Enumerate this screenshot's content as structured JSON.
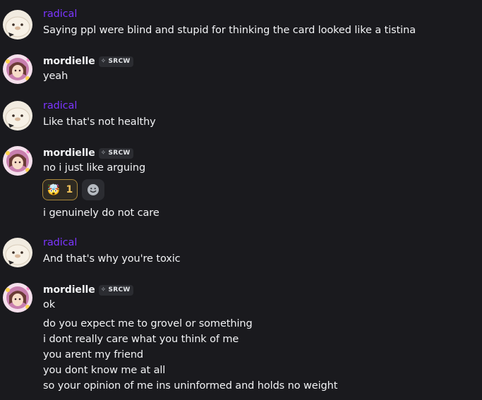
{
  "users": {
    "radical": {
      "name": "radical",
      "color": "#7c35ff",
      "avatar_icon": "seal-plush-avatar"
    },
    "mordielle": {
      "name": "mordielle",
      "tag": "SRCW",
      "tag_icon": "sparkle-diamond-icon",
      "avatar_icon": "anime-girl-sparkle-avatar"
    }
  },
  "messages": [
    {
      "author": "radical",
      "lines": [
        "Saying ppl were blind and stupid for thinking the card looked like a tistina"
      ]
    },
    {
      "author": "mordielle",
      "lines": [
        "yeah"
      ]
    },
    {
      "author": "radical",
      "lines": [
        "Like that's not healthy"
      ]
    },
    {
      "author": "mordielle",
      "lines": [
        "no i just like arguing"
      ],
      "reactions": [
        {
          "emoji": "🤯",
          "count": "1"
        }
      ],
      "followups": [
        "i genuinely do not care"
      ]
    },
    {
      "author": "radical",
      "lines": [
        "And that's why you're toxic"
      ]
    },
    {
      "author": "mordielle",
      "lines": [
        "ok"
      ],
      "followups": [
        "do you expect me to grovel or something",
        "i dont really care what you think of me",
        "you arent my friend",
        "you dont know me at all",
        "so your opinion of me ins uninformed and holds no weight"
      ]
    }
  ]
}
